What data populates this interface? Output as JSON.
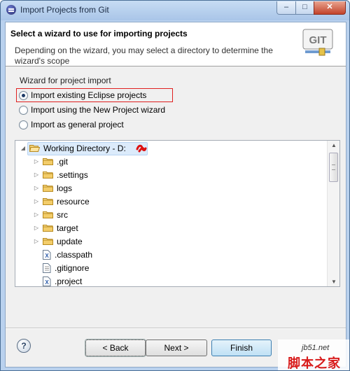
{
  "window": {
    "title": "Import Projects from Git"
  },
  "header": {
    "title": "Select a wizard to use for importing projects",
    "description": "Depending on the wizard, you may select a directory to determine the wizard's scope",
    "logo_text": "GIT"
  },
  "wizard_group": {
    "label": "Wizard for project import",
    "options": [
      {
        "label": "Import existing Eclipse projects",
        "selected": true
      },
      {
        "label": "Import using the New Project wizard",
        "selected": false
      },
      {
        "label": "Import as general project",
        "selected": false
      }
    ]
  },
  "tree": {
    "root": {
      "label": "Working Directory - D:",
      "expanded": true
    },
    "items": [
      {
        "label": ".git",
        "type": "folder"
      },
      {
        "label": ".settings",
        "type": "folder"
      },
      {
        "label": "logs",
        "type": "folder"
      },
      {
        "label": "resource",
        "type": "folder"
      },
      {
        "label": "src",
        "type": "folder"
      },
      {
        "label": "target",
        "type": "folder"
      },
      {
        "label": "update",
        "type": "folder"
      },
      {
        "label": ".classpath",
        "type": "xml-file"
      },
      {
        "label": ".gitignore",
        "type": "text-file"
      },
      {
        "label": ".project",
        "type": "xml-file"
      }
    ]
  },
  "buttons": {
    "help": "?",
    "back": "< Back",
    "next": "Next >",
    "finish": "Finish"
  },
  "watermark": {
    "url": "jb51.net",
    "text": "脚本之家"
  },
  "colors": {
    "folder": "#e8b84a",
    "selection_border": "#e02020",
    "finish_accent": "#3c7fb1"
  }
}
